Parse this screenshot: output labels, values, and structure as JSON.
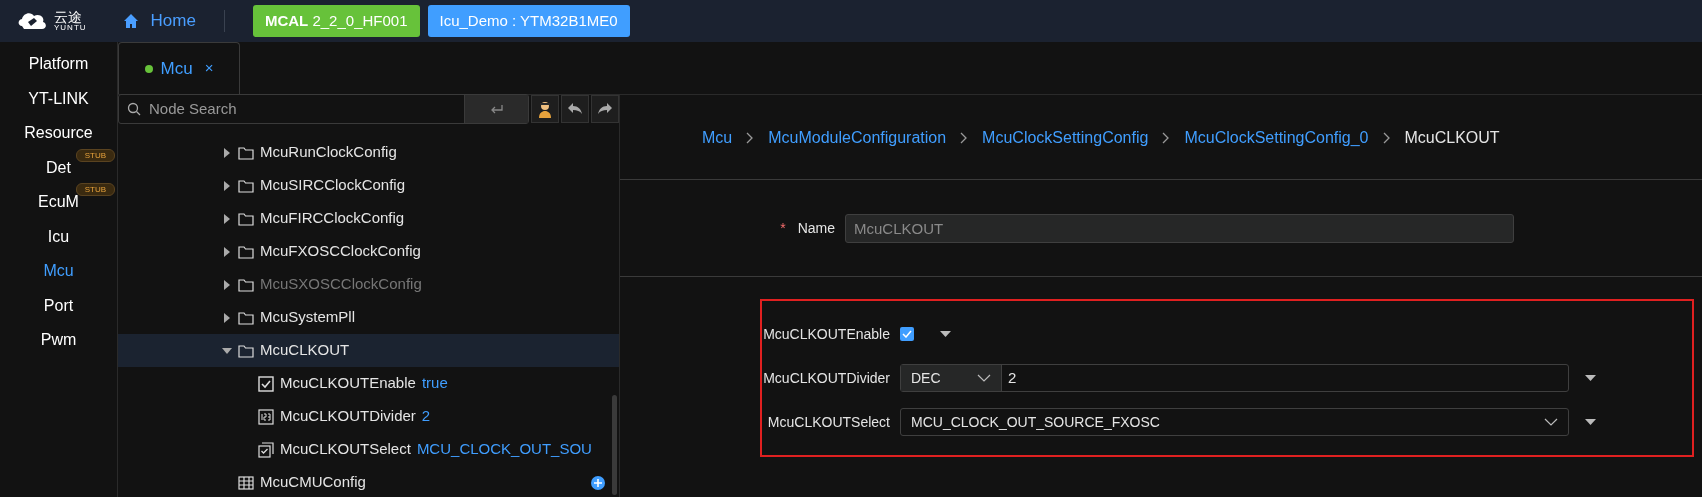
{
  "header": {
    "logo_text": "云途",
    "logo_subtext": "YUNTU",
    "home": "Home",
    "version_badge": "**MCAL** 2_2_0_HF001",
    "project_badge": "Icu_Demo : YTM32B1ME0"
  },
  "sidebar": {
    "items": [
      {
        "label": "Platform",
        "selected": false
      },
      {
        "label": "YT-LINK",
        "selected": false
      },
      {
        "label": "Resource",
        "selected": false
      },
      {
        "label": "Det",
        "selected": false,
        "badge": "STUB"
      },
      {
        "label": "EcuM",
        "selected": false,
        "badge": "STUB"
      },
      {
        "label": "Icu",
        "selected": false
      },
      {
        "label": "Mcu",
        "selected": true
      },
      {
        "label": "Port",
        "selected": false
      },
      {
        "label": "Pwm",
        "selected": false
      }
    ]
  },
  "tabs": [
    {
      "label": "Mcu",
      "selected": true,
      "color": "#67c23a",
      "close": "×"
    }
  ],
  "search": {
    "placeholder": "Node Search"
  },
  "tree": {
    "items": [
      {
        "kind": "folder",
        "label": "McuRunClockConfig",
        "expanded": false,
        "selected": false,
        "disabled": false
      },
      {
        "kind": "folder",
        "label": "McuSIRCClockConfig",
        "expanded": false,
        "selected": false,
        "disabled": false
      },
      {
        "kind": "folder",
        "label": "McuFIRCClockConfig",
        "expanded": false,
        "selected": false,
        "disabled": false
      },
      {
        "kind": "folder",
        "label": "McuFXOSCClockConfig",
        "expanded": false,
        "selected": false,
        "disabled": false
      },
      {
        "kind": "folder",
        "label": "McuSXOSCClockConfig",
        "expanded": false,
        "selected": false,
        "disabled": true
      },
      {
        "kind": "folder",
        "label": "McuSystemPll",
        "expanded": false,
        "selected": false,
        "disabled": false
      },
      {
        "kind": "folder",
        "label": "McuCLKOUT",
        "expanded": true,
        "selected": true,
        "disabled": false,
        "children": [
          {
            "kind": "boolean",
            "label": "McuCLKOUTEnable",
            "value": "true",
            "selected": false,
            "disabled": false
          },
          {
            "kind": "integer",
            "label": "McuCLKOUTDivider",
            "value": "2",
            "selected": false,
            "disabled": false
          },
          {
            "kind": "enum",
            "label": "McuCLKOUTSelect",
            "value": "MCU_CLOCK_OUT_SOU",
            "selected": false,
            "disabled": false
          }
        ]
      },
      {
        "kind": "list",
        "label": "McuCMUConfig",
        "expanded": false,
        "selected": false,
        "disabled": false
      }
    ]
  },
  "breadcrumb": [
    "Mcu",
    "McuModuleConfiguration",
    "McuClockSettingConfig",
    "McuClockSettingConfig_0",
    "McuCLKOUT"
  ],
  "name_field": {
    "label": "Name",
    "required_mark": "*",
    "value": "McuCLKOUT"
  },
  "params": [
    {
      "kind": "checkbox",
      "label": "McuCLKOUTEnable",
      "checked": true
    },
    {
      "kind": "number",
      "label": "McuCLKOUTDivider",
      "format": "DEC",
      "value": "2"
    },
    {
      "kind": "select",
      "label": "McuCLKOUTSelect",
      "value": "MCU_CLOCK_OUT_SOURCE_FXOSC"
    }
  ]
}
